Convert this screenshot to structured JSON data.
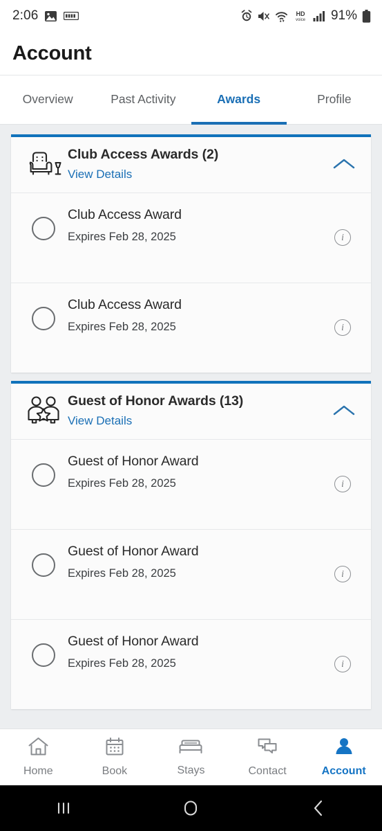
{
  "statusbar": {
    "time": "2:06",
    "battery_percent": "91%",
    "left_icons": [
      "photo-icon",
      "keyboard-icon"
    ],
    "right_icons": [
      "alarm-icon",
      "mute-icon",
      "wifi-icon",
      "hd-voice-icon",
      "signal-icon"
    ],
    "hd_voice_top": "HD",
    "hd_voice_bottom": "voice"
  },
  "header": {
    "title": "Account"
  },
  "tabs": [
    {
      "label": "Overview",
      "active": false
    },
    {
      "label": "Past Activity",
      "active": false
    },
    {
      "label": "Awards",
      "active": true
    },
    {
      "label": "Profile",
      "active": false
    }
  ],
  "sections": [
    {
      "icon": "armchair-icon",
      "title": "Club Access Awards (2)",
      "view_details": "View Details",
      "chevron": "chevron-up-icon",
      "rows": [
        {
          "title": "Club Access Award",
          "expires": "Expires Feb 28, 2025",
          "info": "i"
        },
        {
          "title": "Club Access Award",
          "expires": "Expires Feb 28, 2025",
          "info": "i"
        }
      ]
    },
    {
      "icon": "two-people-star-icon",
      "title": "Guest of Honor Awards (13)",
      "view_details": "View Details",
      "chevron": "chevron-up-icon",
      "rows": [
        {
          "title": "Guest of Honor Award",
          "expires": "Expires Feb 28, 2025",
          "info": "i"
        },
        {
          "title": "Guest of Honor Award",
          "expires": "Expires Feb 28, 2025",
          "info": "i"
        },
        {
          "title": "Guest of Honor Award",
          "expires": "Expires Feb 28, 2025",
          "info": "i"
        }
      ]
    }
  ],
  "bottom_nav": [
    {
      "label": "Home",
      "icon": "house-icon",
      "active": false
    },
    {
      "label": "Book",
      "icon": "calendar-icon",
      "active": false
    },
    {
      "label": "Stays",
      "icon": "bed-icon",
      "active": false
    },
    {
      "label": "Contact",
      "icon": "chat-bubbles-icon",
      "active": false
    },
    {
      "label": "Account",
      "icon": "person-icon",
      "active": true
    }
  ],
  "android_nav": [
    {
      "icon": "recents-icon"
    },
    {
      "icon": "home-circle-icon"
    },
    {
      "icon": "back-chevron-icon"
    }
  ],
  "colors": {
    "accent_blue": "#1a6fb5",
    "card_top_blue": "#1072bb",
    "active_nav_blue": "#1574c4",
    "page_bg": "#eceef0",
    "card_bg": "#fbfbfb"
  }
}
